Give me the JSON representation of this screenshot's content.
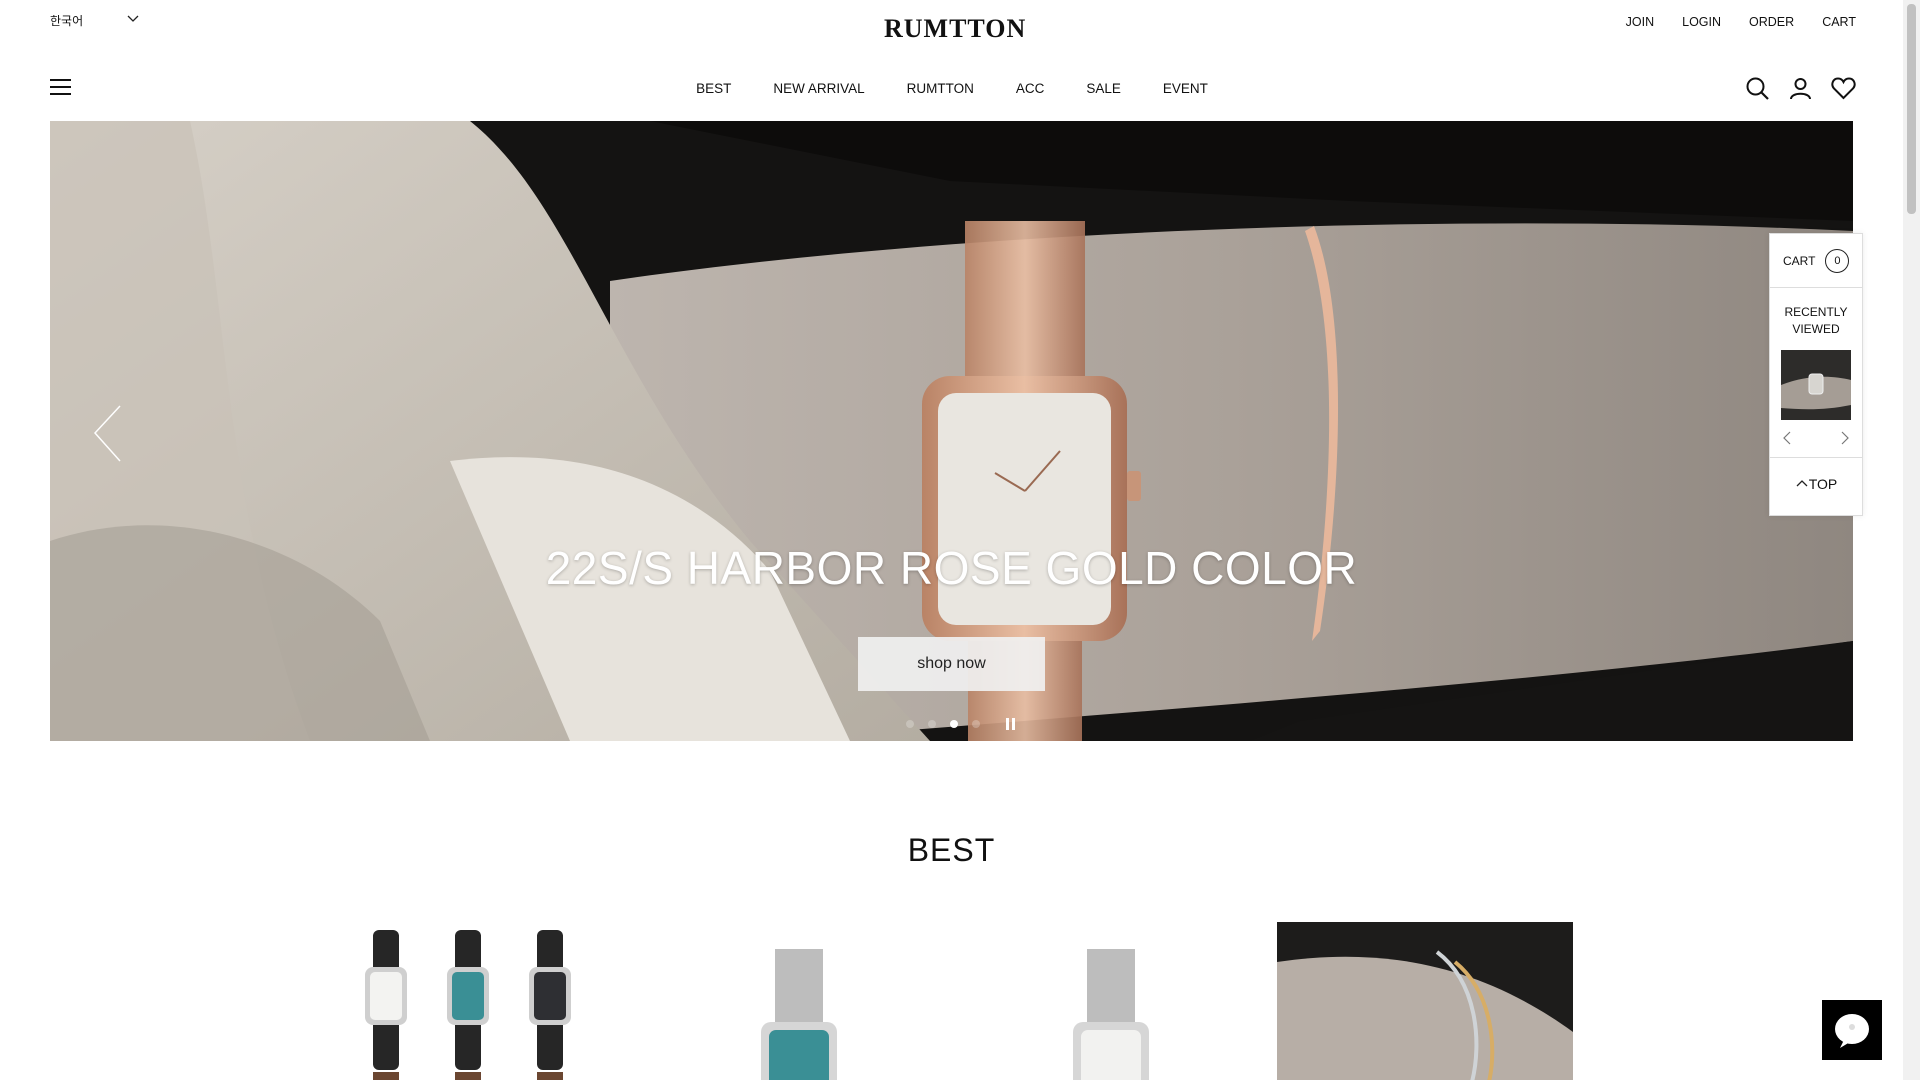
{
  "header": {
    "language": "한국어",
    "logo": "RUMTTON",
    "util_links": [
      "JOIN",
      "LOGIN",
      "ORDER",
      "CART"
    ]
  },
  "nav": {
    "menu": [
      "BEST",
      "NEW ARRIVAL",
      "RUMTTON",
      "ACC",
      "SALE",
      "EVENT"
    ],
    "icons": [
      "search-icon",
      "user-icon",
      "heart-icon"
    ]
  },
  "hero": {
    "title": "22S/S HARBOR ROSE GOLD COLOR",
    "button": "shop now",
    "slide_count": 5,
    "active_slide": 3
  },
  "quick_panel": {
    "cart_label": "CART",
    "cart_count": "0",
    "recent_line1": "RECENTLY",
    "recent_line2": "VIEWED",
    "top_label": "TOP"
  },
  "best": {
    "title": "BEST"
  },
  "colors": {
    "text": "#111111",
    "rose_gold": "#d8a587"
  }
}
